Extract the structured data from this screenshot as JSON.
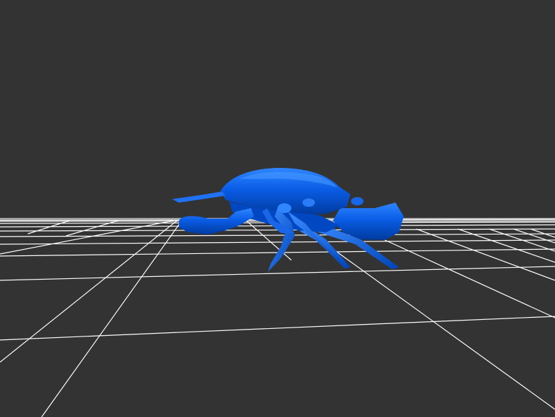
{
  "scene": {
    "background_color": "#333333",
    "grid_color": "#ffffff",
    "model": {
      "subject": "crab",
      "color": "#0050d8"
    }
  }
}
